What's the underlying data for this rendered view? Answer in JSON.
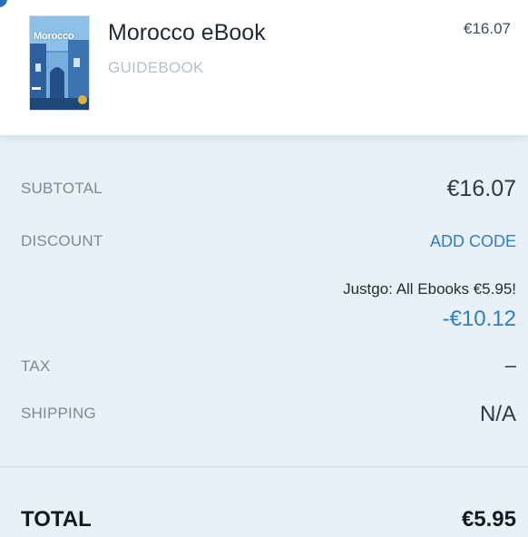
{
  "cart_item": {
    "title": "Morocco eBook",
    "type": "GUIDEBOOK",
    "price": "€16.07",
    "cover_title": "Morocco"
  },
  "summary": {
    "subtotal_label": "SUBTOTAL",
    "subtotal_value": "€16.07",
    "discount_label": "DISCOUNT",
    "add_code_label": "ADD CODE",
    "promo_text": "Justgo: All Ebooks €5.95!",
    "promo_amount": "-€10.12",
    "tax_label": "TAX",
    "tax_value": "–",
    "shipping_label": "SHIPPING",
    "shipping_value": "N/A",
    "total_label": "TOTAL",
    "total_value": "€5.95"
  },
  "colors": {
    "accent": "#2f7ec2",
    "background": "#e9f0f7"
  }
}
